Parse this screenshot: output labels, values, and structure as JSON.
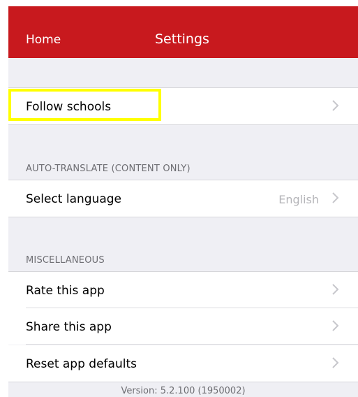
{
  "navbar": {
    "back_label": "Home",
    "title": "Settings",
    "background": "#c8191e"
  },
  "sections": {
    "follow": {
      "rows": [
        {
          "label": "Follow schools",
          "icon": "chevron-right-icon"
        }
      ]
    },
    "translate": {
      "header": "AUTO-TRANSLATE (CONTENT ONLY)",
      "rows": [
        {
          "label": "Select language",
          "value": "English",
          "icon": "chevron-right-icon"
        }
      ]
    },
    "misc": {
      "header": "MISCELLANEOUS",
      "rows": [
        {
          "label": "Rate this app",
          "icon": "chevron-right-icon"
        },
        {
          "label": "Share this app",
          "icon": "chevron-right-icon"
        },
        {
          "label": "Reset app defaults",
          "icon": "chevron-right-icon"
        }
      ]
    }
  },
  "footer": {
    "version": "Version: 5.2.100 (1950002)"
  },
  "highlight_color": "#ffff00"
}
